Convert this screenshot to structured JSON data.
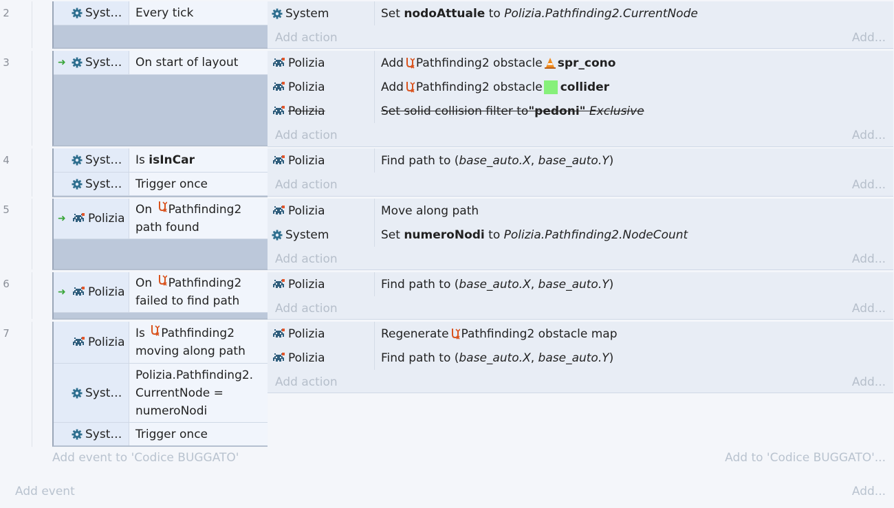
{
  "events": [
    {
      "number": "2"
    },
    {
      "number": "3"
    },
    {
      "number": "4"
    },
    {
      "number": "5"
    },
    {
      "number": "6"
    },
    {
      "number": "7"
    }
  ],
  "objects": {
    "system_short": "Syst…",
    "system": "System",
    "polizia": "Polizia"
  },
  "ev2": {
    "cond1": "Every tick",
    "act1": {
      "pre": "Set ",
      "var": "nodoAttuale",
      "mid": " to ",
      "expr": "Polizia.Pathfinding2.CurrentNode"
    }
  },
  "ev3": {
    "cond1": "On start of layout",
    "act1": {
      "pre": "Add ",
      "beh": "Pathfinding2 obstacle ",
      "obj": "spr_cono"
    },
    "act2": {
      "pre": "Add ",
      "beh": "Pathfinding2 obstacle ",
      "obj": "collider"
    },
    "act3": {
      "pre": "Set solid collision filter to ",
      "val": "\"pedoni\"",
      "post": "Exclusive"
    }
  },
  "ev4": {
    "cond1": {
      "pre": "Is ",
      "var": "isInCar"
    },
    "cond2": "Trigger once",
    "act1": {
      "pre": "Find path to (",
      "x": "base_auto.X",
      "sep": ", ",
      "y": "base_auto.Y",
      "post": ")"
    }
  },
  "ev5": {
    "cond1": {
      "pre": "On ",
      "beh": "Pathfinding2",
      "line2": "path found"
    },
    "act1": "Move along path",
    "act2": {
      "pre": "Set ",
      "var": "numeroNodi",
      "mid": " to ",
      "expr": "Polizia.Pathfinding2.NodeCount"
    }
  },
  "ev6": {
    "cond1": {
      "pre": "On ",
      "beh": "Pathfinding2",
      "line2": "failed to find path"
    },
    "act1": {
      "pre": "Find path to (",
      "x": "base_auto.X",
      "sep": ", ",
      "y": "base_auto.Y",
      "post": ")"
    }
  },
  "ev7": {
    "cond1": {
      "pre": "Is ",
      "beh": "Pathfinding2",
      "line2": "moving along path"
    },
    "cond2": {
      "l1": "Polizia.Pathfinding2.",
      "l2": "CurrentNode =",
      "l3": "numeroNodi"
    },
    "cond3": "Trigger once",
    "act1": {
      "pre": "Regenerate ",
      "beh": "Pathfinding2 obstacle map"
    },
    "act2": {
      "pre": "Find path to (",
      "x": "base_auto.X",
      "sep": ", ",
      "y": "base_auto.Y",
      "post": ")"
    }
  },
  "labels": {
    "add_action": "Add action",
    "add_short": "Add...",
    "add_event_group": "Add event to 'Codice BUGGATO'",
    "add_to_group": "Add to 'Codice BUGGATO'...",
    "add_event": "Add event"
  },
  "colors": {
    "cond_bg": "#e3ebf8",
    "action_bg": "#e8edf5",
    "trigger_arrow": "#3aa63a",
    "collider_swatch": "#86f07a",
    "pathfinding_icon": "#d9531e"
  }
}
